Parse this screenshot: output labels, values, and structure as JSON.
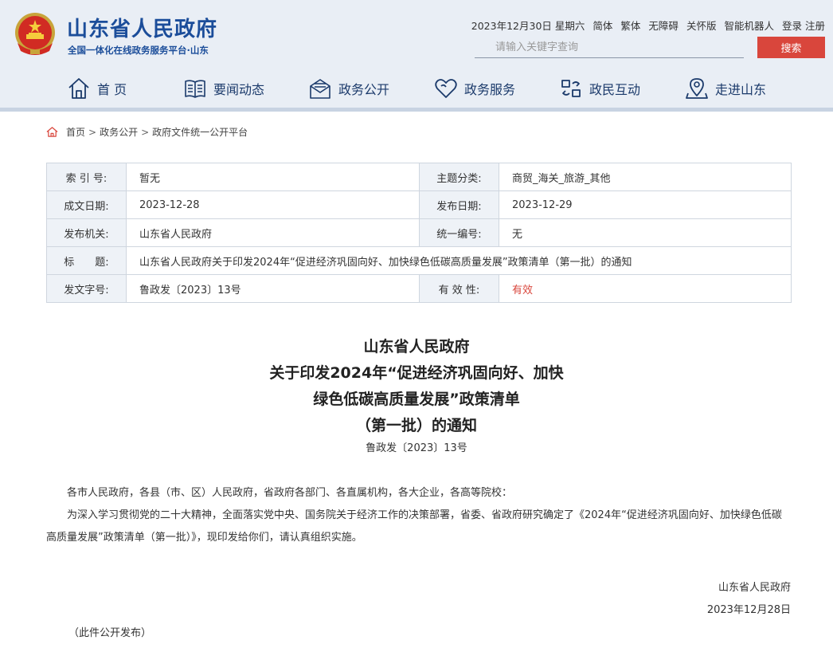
{
  "site": {
    "title": "山东省人民政府",
    "subtitle": "全国一体化在线政务服务平台·山东"
  },
  "toplinks": {
    "date": "2023年12月30日 星期六",
    "simplified": "简体",
    "traditional": "繁体",
    "accessibility": "无障碍",
    "elderly": "关怀版",
    "robot": "智能机器人",
    "login": "登录",
    "register": "注册"
  },
  "search": {
    "placeholder": "请输入关键字查询",
    "button": "搜索"
  },
  "nav": [
    {
      "label": "首 页",
      "icon": "home-icon"
    },
    {
      "label": "要闻动态",
      "icon": "book-icon"
    },
    {
      "label": "政务公开",
      "icon": "envelope-icon"
    },
    {
      "label": "政务服务",
      "icon": "heart-icon"
    },
    {
      "label": "政民互动",
      "icon": "interaction-icon"
    },
    {
      "label": "走进山东",
      "icon": "location-icon"
    }
  ],
  "breadcrumb": [
    "首页",
    "政务公开",
    "政府文件统一公开平台"
  ],
  "meta": {
    "index_no_k": "索 引 号:",
    "index_no_v": "暂无",
    "topic_k": "主题分类:",
    "topic_v": "商贸_海关_旅游_其他",
    "made_k": "成文日期:",
    "made_v": "2023-12-28",
    "pub_k": "发布日期:",
    "pub_v": "2023-12-29",
    "org_k": "发布机关:",
    "org_v": "山东省人民政府",
    "code_k": "统一编号:",
    "code_v": "无",
    "title_k": "标　　题:",
    "title_v": "山东省人民政府关于印发2024年“促进经济巩固向好、加快绿色低碳高质量发展”政策清单（第一批）的通知",
    "docno_k": "发文字号:",
    "docno_v": "鲁政发〔2023〕13号",
    "valid_k": "有 效 性:",
    "valid_v": "有效"
  },
  "doc": {
    "title_lines": [
      "山东省人民政府",
      "关于印发2024年“促进经济巩固向好、加快",
      "绿色低碳高质量发展”政策清单",
      "（第一批）的通知"
    ],
    "number": "鲁政发〔2023〕13号",
    "salutation": "各市人民政府，各县（市、区）人民政府，省政府各部门、各直属机构，各大企业，各高等院校：",
    "paragraph": "为深入学习贯彻党的二十大精神，全面落实党中央、国务院关于经济工作的决策部署，省委、省政府研究确定了《2024年“促进经济巩固向好、加快绿色低碳高质量发展”政策清单（第一批）》，现印发给你们，请认真组织实施。",
    "signer": "山东省人民政府",
    "sign_date": "2023年12月28日",
    "note": "（此件公开发布）"
  },
  "colors": {
    "brand": "#1b4d9a",
    "accent_red": "#d9463c",
    "header_bg": "#e9eef5"
  }
}
